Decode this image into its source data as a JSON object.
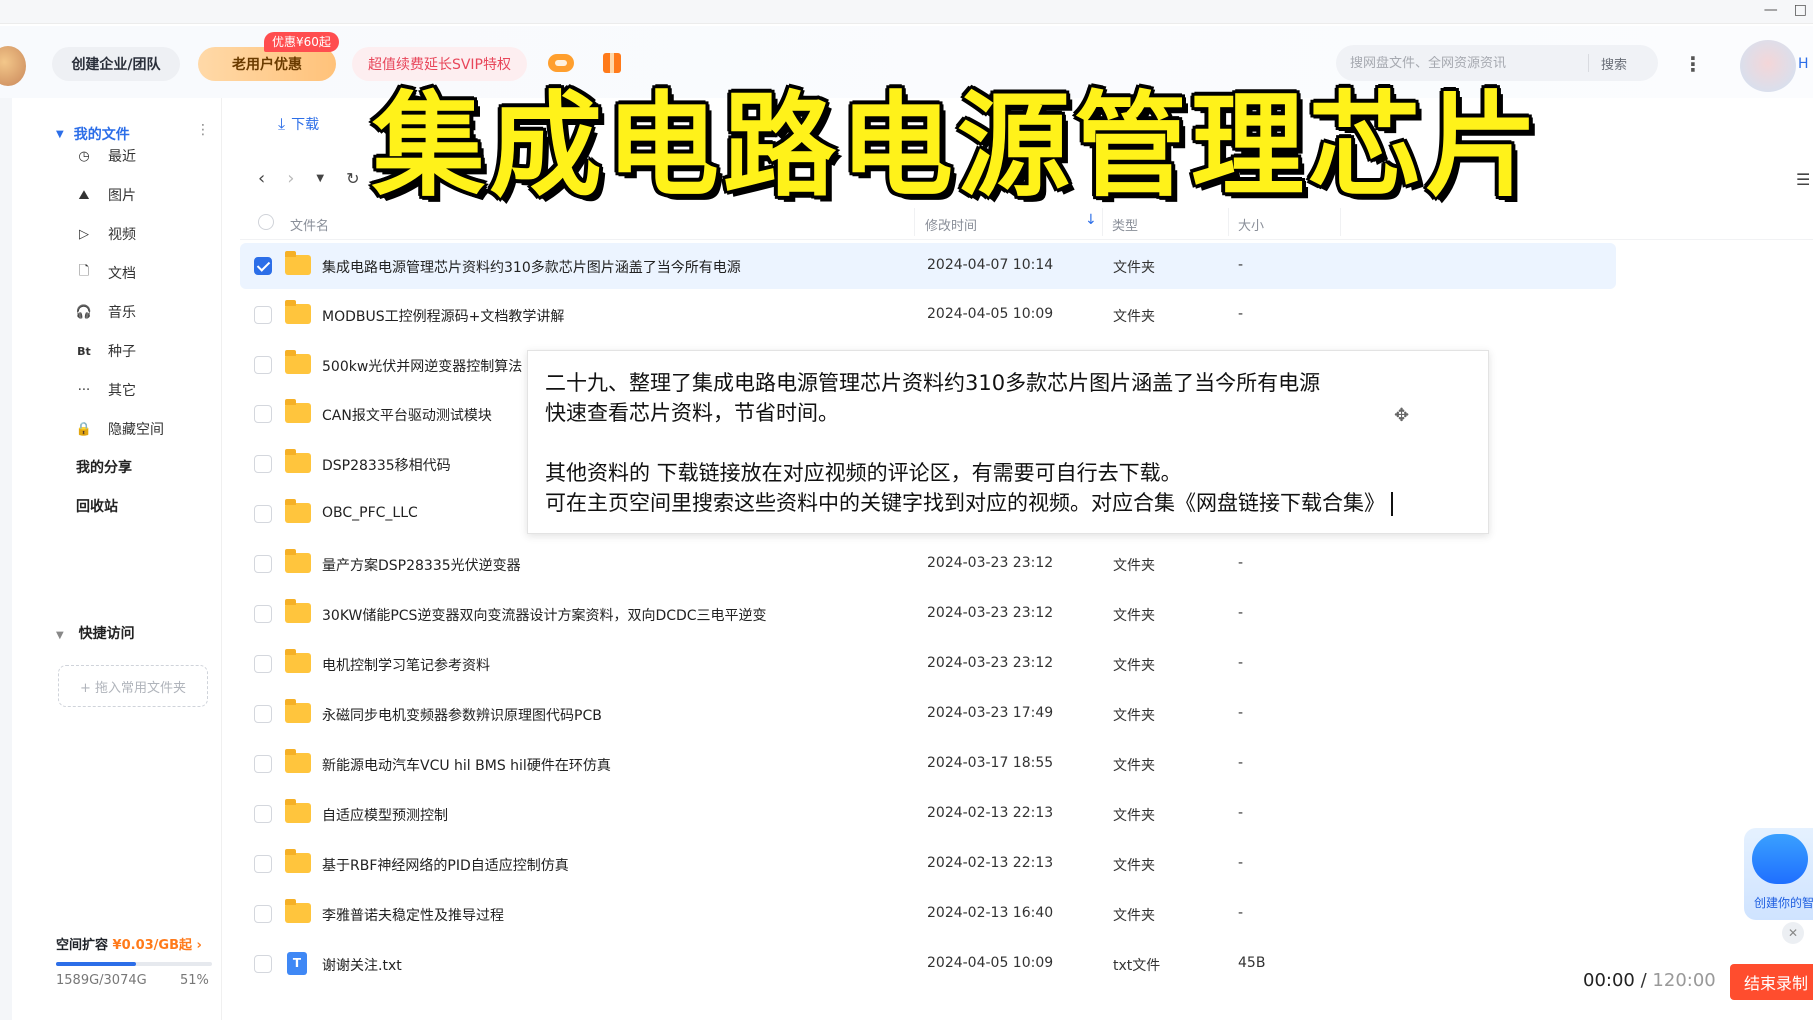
{
  "window": {
    "min_label": "—",
    "max_label": "□"
  },
  "topbar": {
    "team_button": "创建企业/团队",
    "old_user_button": "老用户优惠",
    "promo_badge": "优惠¥60起",
    "svip_button": "超值续费延长SVIP特权",
    "search_placeholder": "搜网盘文件、全网资源资讯",
    "search_button": "搜索",
    "avatar_text": "H"
  },
  "sidebar": {
    "my_files": "我的文件",
    "items": [
      {
        "label": "最近",
        "icon": "clock-icon",
        "glyph": "◷"
      },
      {
        "label": "图片",
        "icon": "image-icon",
        "glyph": "⛰"
      },
      {
        "label": "视频",
        "icon": "video-icon",
        "glyph": "▷"
      },
      {
        "label": "文档",
        "icon": "document-icon",
        "glyph": "🗋"
      },
      {
        "label": "音乐",
        "icon": "headphones-icon",
        "glyph": "🎧"
      },
      {
        "label": "种子",
        "icon": "torrent-icon",
        "glyph": "Bt"
      },
      {
        "label": "其它",
        "icon": "more-icon",
        "glyph": "···"
      },
      {
        "label": "隐藏空间",
        "icon": "lock-icon",
        "glyph": "🔒"
      }
    ],
    "my_share": "我的分享",
    "recycle_bin": "回收站",
    "quick_access": "快捷访问",
    "quick_drop": "+ 拖入常用文件夹",
    "space_label": "空间扩容",
    "space_price": "¥0.03/GB起",
    "space_used": "1589G/3074G",
    "space_percent": "51%",
    "space_fraction": 0.51
  },
  "toolbar": {
    "download": "下载",
    "more": "···"
  },
  "table": {
    "headers": {
      "name": "文件名",
      "modified": "修改时间",
      "type": "类型",
      "size": "大小"
    },
    "rows": [
      {
        "name": "集成电路电源管理芯片资料约310多款芯片图片涵盖了当今所有电源",
        "time": "2024-04-07 10:14",
        "type": "文件夹",
        "size": "-",
        "selected": true,
        "kind": "folder"
      },
      {
        "name": "MODBUS工控例程源码+文档教学讲解",
        "time": "2024-04-05 10:09",
        "type": "文件夹",
        "size": "-",
        "kind": "folder"
      },
      {
        "name": "500kw光伏并网逆变器控制算法",
        "time": "",
        "type": "",
        "size": "",
        "kind": "folder"
      },
      {
        "name": "CAN报文平台驱动测试模块",
        "time": "",
        "type": "",
        "size": "",
        "kind": "folder"
      },
      {
        "name": "DSP28335移相代码",
        "time": "",
        "type": "",
        "size": "",
        "kind": "folder"
      },
      {
        "name": "OBC_PFC_LLC",
        "time": "",
        "type": "",
        "size": "",
        "kind": "folder"
      },
      {
        "name": "量产方案DSP28335光伏逆变器",
        "time": "2024-03-23 23:12",
        "type": "文件夹",
        "size": "-",
        "kind": "folder"
      },
      {
        "name": "30KW储能PCS逆变器双向变流器设计方案资料，双向DCDC三电平逆变",
        "time": "2024-03-23 23:12",
        "type": "文件夹",
        "size": "-",
        "kind": "folder"
      },
      {
        "name": "电机控制学习笔记参考资料",
        "time": "2024-03-23 23:12",
        "type": "文件夹",
        "size": "-",
        "kind": "folder"
      },
      {
        "name": "永磁同步电机变频器参数辨识原理图代码PCB",
        "time": "2024-03-23 17:49",
        "type": "文件夹",
        "size": "-",
        "kind": "folder"
      },
      {
        "name": "新能源电动汽车VCU hil BMS hil硬件在环仿真",
        "time": "2024-03-17 18:55",
        "type": "文件夹",
        "size": "-",
        "kind": "folder"
      },
      {
        "name": "自适应模型预测控制",
        "time": "2024-02-13 22:13",
        "type": "文件夹",
        "size": "-",
        "kind": "folder"
      },
      {
        "name": "基于RBF神经网络的PID自适应控制仿真",
        "time": "2024-02-13 22:13",
        "type": "文件夹",
        "size": "-",
        "kind": "folder"
      },
      {
        "name": "李雅普诺夫稳定性及推导过程",
        "time": "2024-02-13 16:40",
        "type": "文件夹",
        "size": "-",
        "kind": "folder"
      },
      {
        "name": "谢谢关注.txt",
        "time": "2024-04-05 10:09",
        "type": "txt文件",
        "size": "45B",
        "kind": "txt"
      }
    ]
  },
  "overlay": {
    "title": "集成电路电源管理芯片",
    "note_line1": "二十九、整理了集成电路电源管理芯片资料约310多款芯片图片涵盖了当今所有电源",
    "note_line2": "快速查看芯片资料，节省时间。",
    "note_line3": "其他资料的 下载链接放在对应视频的评论区，有需要可自行去下载。",
    "note_line4": "可在主页空间里搜索这些资料中的关键字找到对应的视频。对应合集《网盘链接下载合集》"
  },
  "recorder": {
    "elapsed": "00:00",
    "separator": "/",
    "total": "120:00",
    "end_button": "结束录制",
    "ai_label": "创建你的智"
  },
  "colors": {
    "accent": "#2c6ee8",
    "title_yellow": "#fff21a",
    "folder": "#ffc53d",
    "end_button": "#ff4d2e"
  }
}
